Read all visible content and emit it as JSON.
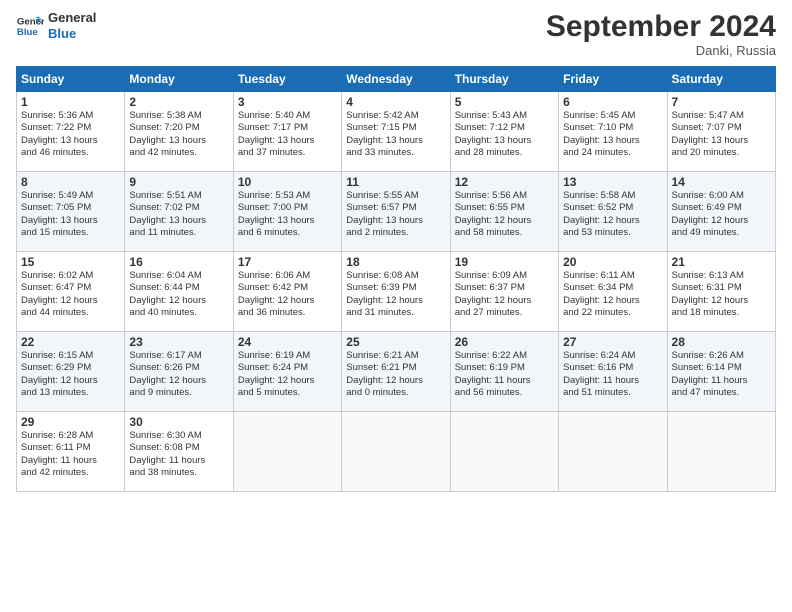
{
  "logo": {
    "line1": "General",
    "line2": "Blue"
  },
  "title": "September 2024",
  "location": "Danki, Russia",
  "days_of_week": [
    "Sunday",
    "Monday",
    "Tuesday",
    "Wednesday",
    "Thursday",
    "Friday",
    "Saturday"
  ],
  "weeks": [
    [
      {
        "day": 1,
        "info": "Sunrise: 5:36 AM\nSunset: 7:22 PM\nDaylight: 13 hours\nand 46 minutes."
      },
      {
        "day": 2,
        "info": "Sunrise: 5:38 AM\nSunset: 7:20 PM\nDaylight: 13 hours\nand 42 minutes."
      },
      {
        "day": 3,
        "info": "Sunrise: 5:40 AM\nSunset: 7:17 PM\nDaylight: 13 hours\nand 37 minutes."
      },
      {
        "day": 4,
        "info": "Sunrise: 5:42 AM\nSunset: 7:15 PM\nDaylight: 13 hours\nand 33 minutes."
      },
      {
        "day": 5,
        "info": "Sunrise: 5:43 AM\nSunset: 7:12 PM\nDaylight: 13 hours\nand 28 minutes."
      },
      {
        "day": 6,
        "info": "Sunrise: 5:45 AM\nSunset: 7:10 PM\nDaylight: 13 hours\nand 24 minutes."
      },
      {
        "day": 7,
        "info": "Sunrise: 5:47 AM\nSunset: 7:07 PM\nDaylight: 13 hours\nand 20 minutes."
      }
    ],
    [
      {
        "day": 8,
        "info": "Sunrise: 5:49 AM\nSunset: 7:05 PM\nDaylight: 13 hours\nand 15 minutes."
      },
      {
        "day": 9,
        "info": "Sunrise: 5:51 AM\nSunset: 7:02 PM\nDaylight: 13 hours\nand 11 minutes."
      },
      {
        "day": 10,
        "info": "Sunrise: 5:53 AM\nSunset: 7:00 PM\nDaylight: 13 hours\nand 6 minutes."
      },
      {
        "day": 11,
        "info": "Sunrise: 5:55 AM\nSunset: 6:57 PM\nDaylight: 13 hours\nand 2 minutes."
      },
      {
        "day": 12,
        "info": "Sunrise: 5:56 AM\nSunset: 6:55 PM\nDaylight: 12 hours\nand 58 minutes."
      },
      {
        "day": 13,
        "info": "Sunrise: 5:58 AM\nSunset: 6:52 PM\nDaylight: 12 hours\nand 53 minutes."
      },
      {
        "day": 14,
        "info": "Sunrise: 6:00 AM\nSunset: 6:49 PM\nDaylight: 12 hours\nand 49 minutes."
      }
    ],
    [
      {
        "day": 15,
        "info": "Sunrise: 6:02 AM\nSunset: 6:47 PM\nDaylight: 12 hours\nand 44 minutes."
      },
      {
        "day": 16,
        "info": "Sunrise: 6:04 AM\nSunset: 6:44 PM\nDaylight: 12 hours\nand 40 minutes."
      },
      {
        "day": 17,
        "info": "Sunrise: 6:06 AM\nSunset: 6:42 PM\nDaylight: 12 hours\nand 36 minutes."
      },
      {
        "day": 18,
        "info": "Sunrise: 6:08 AM\nSunset: 6:39 PM\nDaylight: 12 hours\nand 31 minutes."
      },
      {
        "day": 19,
        "info": "Sunrise: 6:09 AM\nSunset: 6:37 PM\nDaylight: 12 hours\nand 27 minutes."
      },
      {
        "day": 20,
        "info": "Sunrise: 6:11 AM\nSunset: 6:34 PM\nDaylight: 12 hours\nand 22 minutes."
      },
      {
        "day": 21,
        "info": "Sunrise: 6:13 AM\nSunset: 6:31 PM\nDaylight: 12 hours\nand 18 minutes."
      }
    ],
    [
      {
        "day": 22,
        "info": "Sunrise: 6:15 AM\nSunset: 6:29 PM\nDaylight: 12 hours\nand 13 minutes."
      },
      {
        "day": 23,
        "info": "Sunrise: 6:17 AM\nSunset: 6:26 PM\nDaylight: 12 hours\nand 9 minutes."
      },
      {
        "day": 24,
        "info": "Sunrise: 6:19 AM\nSunset: 6:24 PM\nDaylight: 12 hours\nand 5 minutes."
      },
      {
        "day": 25,
        "info": "Sunrise: 6:21 AM\nSunset: 6:21 PM\nDaylight: 12 hours\nand 0 minutes."
      },
      {
        "day": 26,
        "info": "Sunrise: 6:22 AM\nSunset: 6:19 PM\nDaylight: 11 hours\nand 56 minutes."
      },
      {
        "day": 27,
        "info": "Sunrise: 6:24 AM\nSunset: 6:16 PM\nDaylight: 11 hours\nand 51 minutes."
      },
      {
        "day": 28,
        "info": "Sunrise: 6:26 AM\nSunset: 6:14 PM\nDaylight: 11 hours\nand 47 minutes."
      }
    ],
    [
      {
        "day": 29,
        "info": "Sunrise: 6:28 AM\nSunset: 6:11 PM\nDaylight: 11 hours\nand 42 minutes."
      },
      {
        "day": 30,
        "info": "Sunrise: 6:30 AM\nSunset: 6:08 PM\nDaylight: 11 hours\nand 38 minutes."
      },
      null,
      null,
      null,
      null,
      null
    ]
  ]
}
